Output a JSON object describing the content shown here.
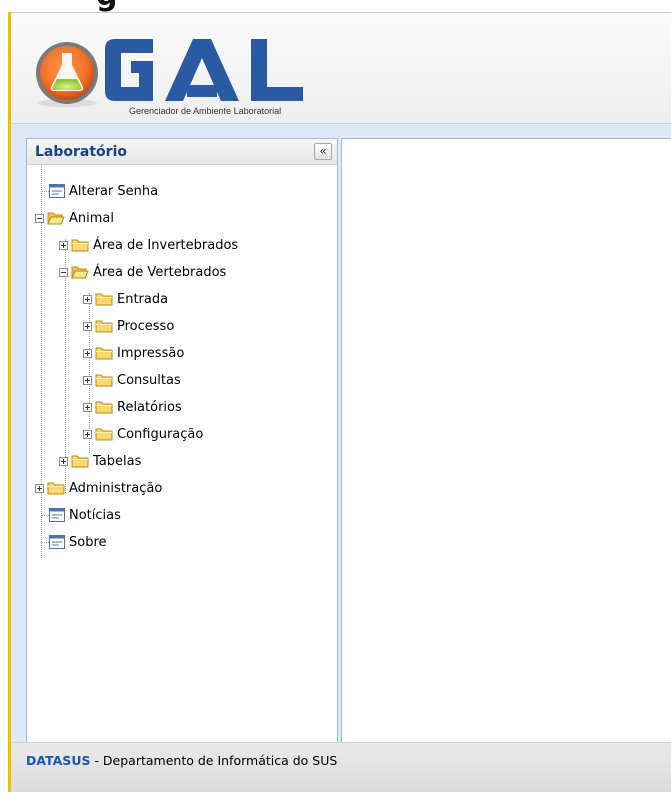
{
  "top_heading": "g",
  "app": {
    "logo": {
      "letters": "GAL",
      "tagline": "Gerenciador de Ambiente Laboratorial"
    },
    "sidebar": {
      "title": "Laboratório",
      "collapse_glyph": "«",
      "tree": [
        {
          "label": "Alterar Senha",
          "type": "leaf",
          "depth": 0
        },
        {
          "label": "Animal",
          "type": "folder",
          "expanded": true,
          "depth": 0
        },
        {
          "label": "Área de Invertebrados",
          "type": "folder",
          "expanded": false,
          "depth": 1
        },
        {
          "label": "Área de Vertebrados",
          "type": "folder",
          "expanded": true,
          "depth": 1
        },
        {
          "label": "Entrada",
          "type": "folder",
          "expanded": false,
          "depth": 2
        },
        {
          "label": "Processo",
          "type": "folder",
          "expanded": false,
          "depth": 2
        },
        {
          "label": "Impressão",
          "type": "folder",
          "expanded": false,
          "depth": 2
        },
        {
          "label": "Consultas",
          "type": "folder",
          "expanded": false,
          "depth": 2
        },
        {
          "label": "Relatórios",
          "type": "folder",
          "expanded": false,
          "depth": 2
        },
        {
          "label": "Configuração",
          "type": "folder",
          "expanded": false,
          "depth": 2
        },
        {
          "label": "Tabelas",
          "type": "folder",
          "expanded": false,
          "depth": 1
        },
        {
          "label": "Administração",
          "type": "folder",
          "expanded": false,
          "depth": 0
        },
        {
          "label": "Notícias",
          "type": "leaf",
          "depth": 0
        },
        {
          "label": "Sobre",
          "type": "leaf",
          "depth": 0
        }
      ]
    },
    "footer": {
      "brand": "DATASUS",
      "text": " - Departamento de Informática do SUS"
    },
    "colors": {
      "frame_accent": "#e8c100",
      "logo_letters": "#2b5aa5",
      "logo_orb": "#f2702a",
      "brand_text": "#1a56b5",
      "panel_border": "#99bbe8"
    },
    "icons": [
      "folder-icon",
      "folder-open-icon",
      "document-icon",
      "expand-icon",
      "collapse-icon",
      "double-chevron-left-icon"
    ]
  }
}
